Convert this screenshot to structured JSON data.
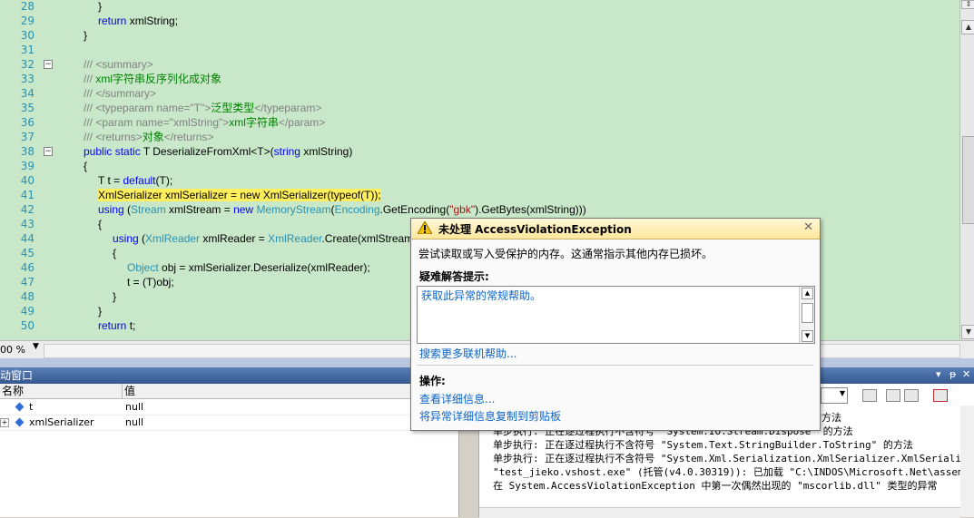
{
  "editor": {
    "lines": [
      {
        "n": "28",
        "indent": 3,
        "parts": [
          {
            "t": "}",
            "c": ""
          }
        ]
      },
      {
        "n": "29",
        "indent": 3,
        "parts": [
          {
            "t": "return",
            "c": "kw"
          },
          {
            "t": " xmlString;",
            "c": ""
          }
        ]
      },
      {
        "n": "30",
        "indent": 2,
        "parts": [
          {
            "t": "}",
            "c": ""
          }
        ]
      },
      {
        "n": "31",
        "indent": 0,
        "parts": []
      },
      {
        "n": "32",
        "indent": 2,
        "collapse": "−",
        "parts": [
          {
            "t": "/// <summary>",
            "c": "cm"
          }
        ]
      },
      {
        "n": "33",
        "indent": 2,
        "parts": [
          {
            "t": "/// ",
            "c": "cm"
          },
          {
            "t": "xml字符串反序列化成对象",
            "c": "cg"
          }
        ]
      },
      {
        "n": "34",
        "indent": 2,
        "parts": [
          {
            "t": "/// </summary>",
            "c": "cm"
          }
        ]
      },
      {
        "n": "35",
        "indent": 2,
        "parts": [
          {
            "t": "/// <typeparam name=\"T\">",
            "c": "cm"
          },
          {
            "t": "泛型类型",
            "c": "cg"
          },
          {
            "t": "</typeparam>",
            "c": "cm"
          }
        ]
      },
      {
        "n": "36",
        "indent": 2,
        "parts": [
          {
            "t": "/// <param name=\"xmlString\">",
            "c": "cm"
          },
          {
            "t": "xml字符串",
            "c": "cg"
          },
          {
            "t": "</param>",
            "c": "cm"
          }
        ]
      },
      {
        "n": "37",
        "indent": 2,
        "parts": [
          {
            "t": "/// <returns>",
            "c": "cm"
          },
          {
            "t": "对象",
            "c": "cg"
          },
          {
            "t": "</returns>",
            "c": "cm"
          }
        ]
      },
      {
        "n": "38",
        "indent": 2,
        "collapse": "−",
        "parts": [
          {
            "t": "public static",
            "c": "kw"
          },
          {
            "t": " T DeserializeFromXml<T>(",
            "c": ""
          },
          {
            "t": "string",
            "c": "kw"
          },
          {
            "t": " xmlString)",
            "c": ""
          }
        ]
      },
      {
        "n": "39",
        "indent": 2,
        "parts": [
          {
            "t": "{",
            "c": ""
          }
        ]
      },
      {
        "n": "40",
        "indent": 3,
        "parts": [
          {
            "t": "T t = ",
            "c": ""
          },
          {
            "t": "default",
            "c": "kw"
          },
          {
            "t": "(T);",
            "c": ""
          }
        ]
      },
      {
        "n": "41",
        "indent": 3,
        "parts": [
          {
            "t": "XmlSerializer xmlSerializer = new XmlSerializer(typeof(T));",
            "c": "hl"
          }
        ]
      },
      {
        "n": "42",
        "indent": 3,
        "parts": [
          {
            "t": "using",
            "c": "kw"
          },
          {
            "t": " (",
            "c": ""
          },
          {
            "t": "Stream",
            "c": "ty"
          },
          {
            "t": " xmlStream = ",
            "c": ""
          },
          {
            "t": "new",
            "c": "kw"
          },
          {
            "t": " ",
            "c": ""
          },
          {
            "t": "MemoryStream",
            "c": "ty"
          },
          {
            "t": "(",
            "c": ""
          },
          {
            "t": "Encoding",
            "c": "ty"
          },
          {
            "t": ".GetEncoding(",
            "c": ""
          },
          {
            "t": "\"gbk\"",
            "c": "st"
          },
          {
            "t": ").GetBytes(xmlString)))",
            "c": ""
          }
        ]
      },
      {
        "n": "43",
        "indent": 3,
        "parts": [
          {
            "t": "{",
            "c": ""
          }
        ]
      },
      {
        "n": "44",
        "indent": 4,
        "parts": [
          {
            "t": "using",
            "c": "kw"
          },
          {
            "t": " (",
            "c": ""
          },
          {
            "t": "XmlReader",
            "c": "ty"
          },
          {
            "t": " xmlReader = ",
            "c": ""
          },
          {
            "t": "XmlReader",
            "c": "ty"
          },
          {
            "t": ".Create(xmlStream))",
            "c": ""
          }
        ]
      },
      {
        "n": "45",
        "indent": 4,
        "parts": [
          {
            "t": "{",
            "c": ""
          }
        ]
      },
      {
        "n": "46",
        "indent": 5,
        "parts": [
          {
            "t": "Object",
            "c": "ty"
          },
          {
            "t": " obj = xmlSerializer.Deserialize(xmlReader);",
            "c": ""
          }
        ]
      },
      {
        "n": "47",
        "indent": 5,
        "parts": [
          {
            "t": "t = (T)obj;",
            "c": ""
          }
        ]
      },
      {
        "n": "48",
        "indent": 4,
        "parts": [
          {
            "t": "}",
            "c": ""
          }
        ]
      },
      {
        "n": "49",
        "indent": 3,
        "parts": [
          {
            "t": "}",
            "c": ""
          }
        ]
      },
      {
        "n": "50",
        "indent": 3,
        "parts": [
          {
            "t": "return",
            "c": "kw"
          },
          {
            "t": " t;",
            "c": ""
          }
        ]
      }
    ],
    "zoom": "00 %"
  },
  "locals": {
    "title": "动窗口",
    "col_name": "名称",
    "col_value": "值",
    "rows": [
      {
        "name": "t",
        "value": "null",
        "expandable": false
      },
      {
        "name": "xmlSerializer",
        "value": "null",
        "expandable": true
      }
    ]
  },
  "output": {
    "lines": [
      "                                               ring\" 的方法",
      "单步执行: 正在逐过程执行不含符号 \"System.IO.Stream.Dispose\" 的方法",
      "单步执行: 正在逐过程执行不含符号 \"System.Text.StringBuilder.ToString\" 的方法",
      "单步执行: 正在逐过程执行不含符号 \"System.Xml.Serialization.XmlSerializer.XmlSerializer",
      "\"test_jieko.vshost.exe\" (托管(v4.0.30319)): 已加载 \"C:\\INDOS\\Microsoft.Net\\assembly\\G",
      "在 System.AccessViolationException 中第一次偶然出现的 \"mscorlib.dll\" 类型的异常"
    ]
  },
  "exception": {
    "title": "未处理 AccessViolationException",
    "message": "尝试读取或写入受保护的内存。这通常指示其他内存已损坏。",
    "tips_heading": "疑难解答提示:",
    "tips": [
      "获取此异常的常规帮助。"
    ],
    "search_link": "搜索更多联机帮助...",
    "actions_heading": "操作:",
    "actions": [
      "查看详细信息...",
      "将异常详细信息复制到剪贴板"
    ]
  }
}
